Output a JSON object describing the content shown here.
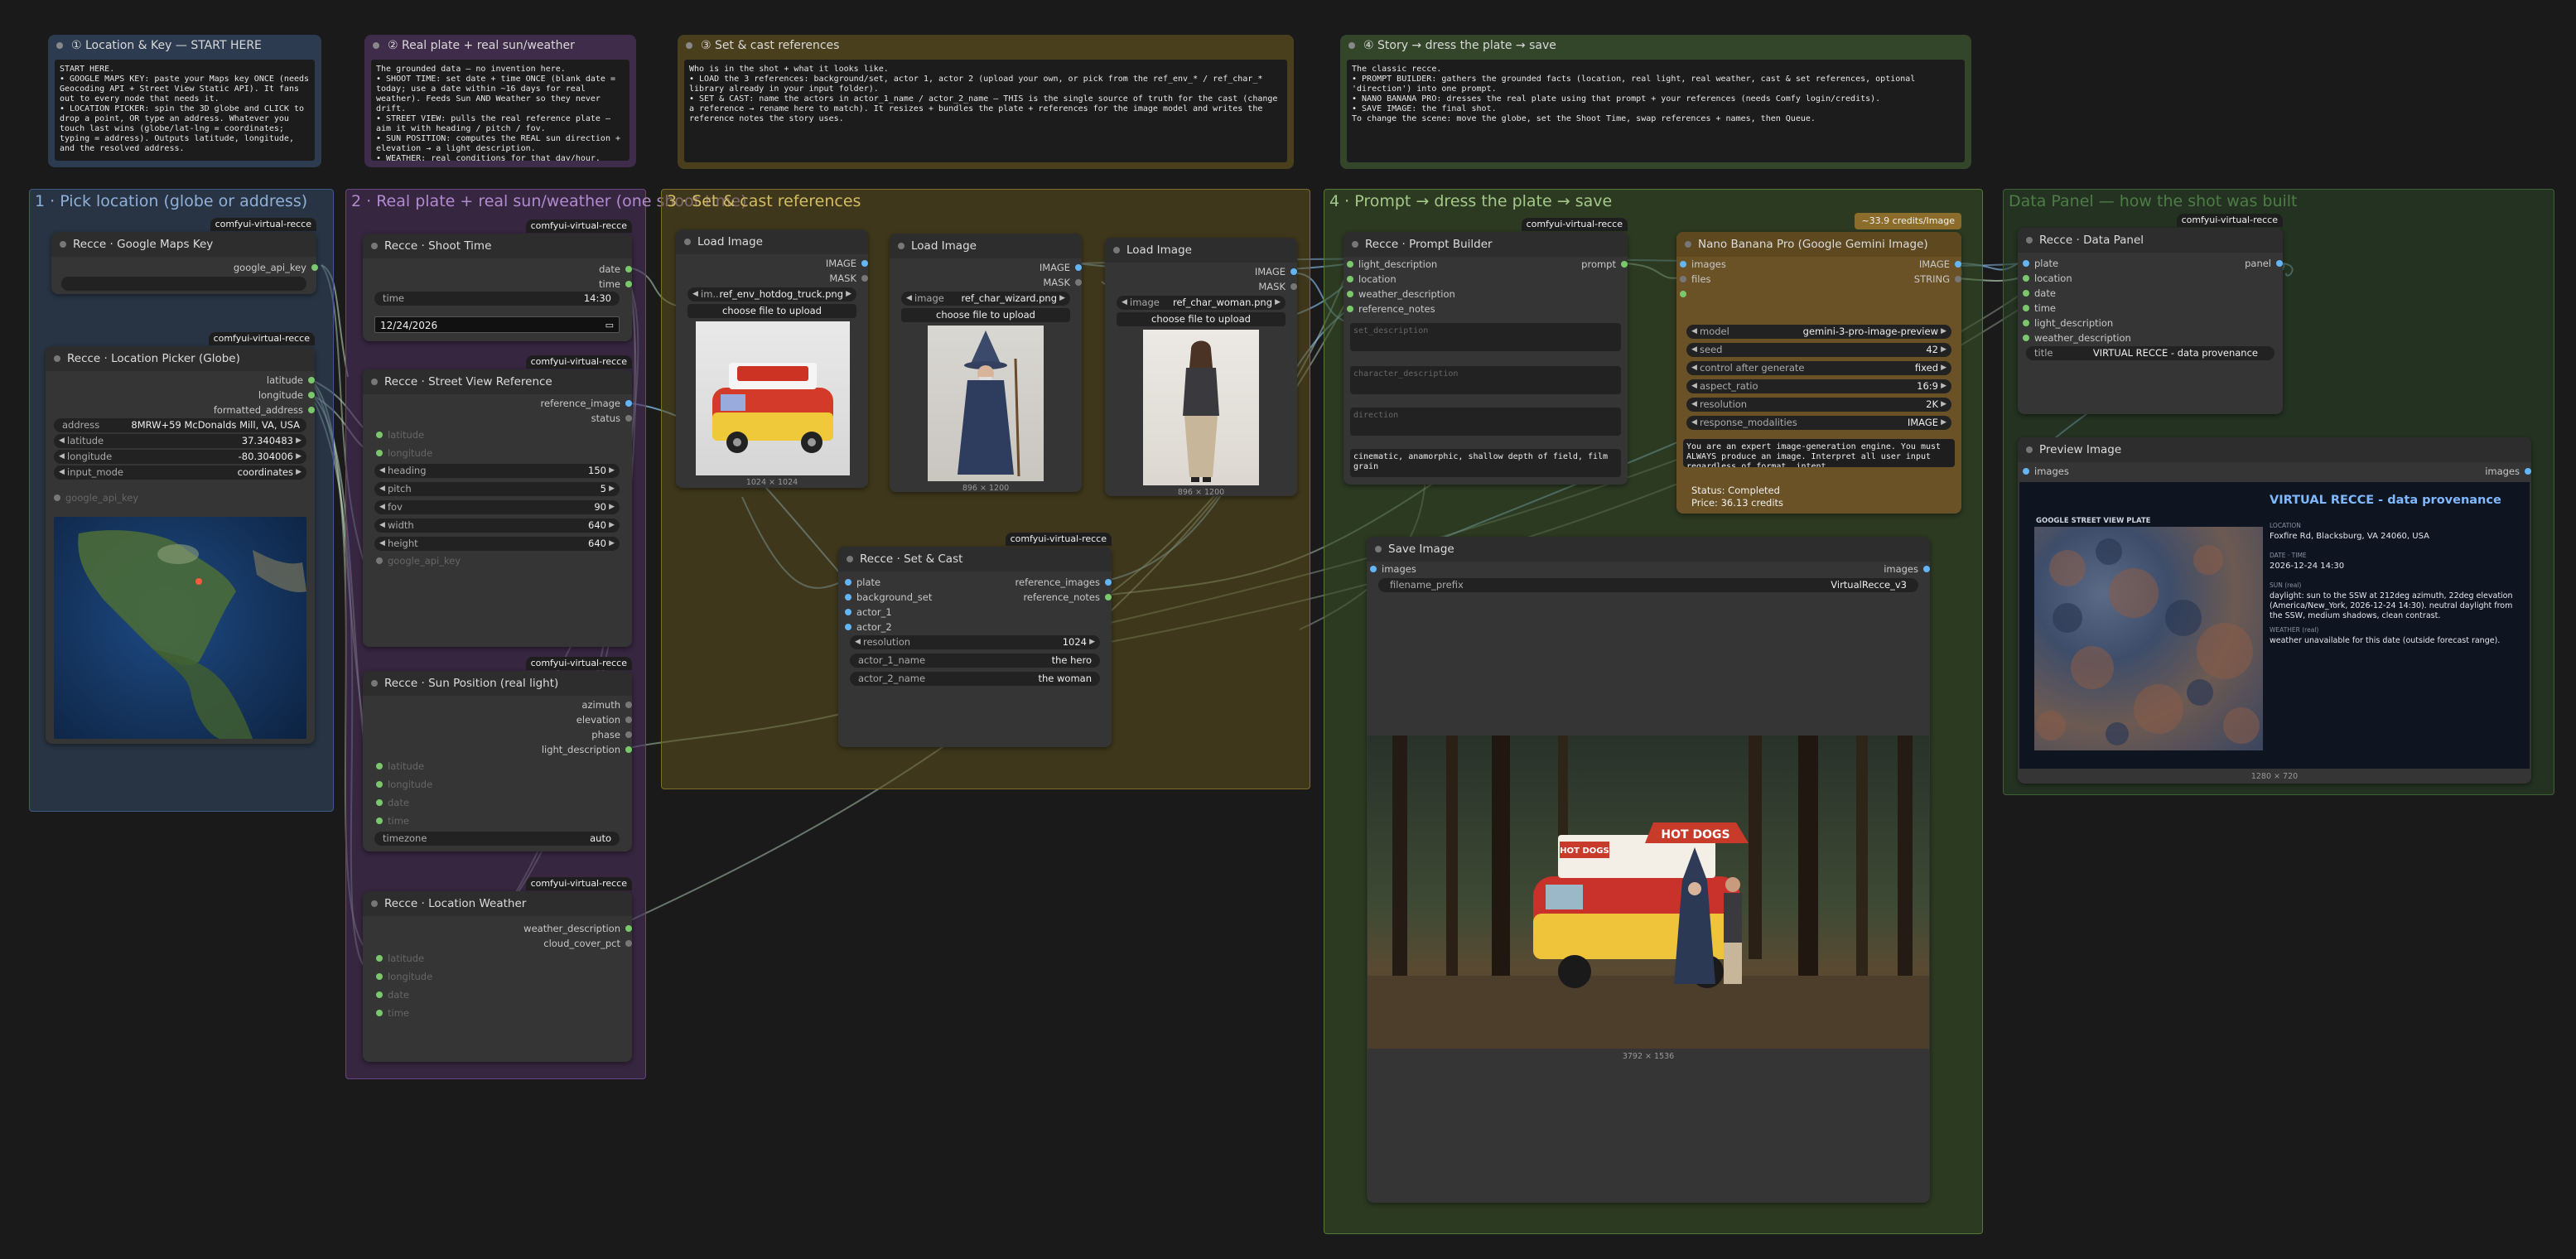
{
  "notes": [
    {
      "title": "① Location & Key — START HERE",
      "body": "START HERE.\n• GOOGLE MAPS KEY: paste your Maps key ONCE (needs Geocoding API + Street View Static API). It fans out to every node that needs it.\n• LOCATION PICKER: spin the 3D globe and CLICK to drop a point, OR type an address. Whatever you touch last wins (globe/lat-lng = coordinates; typing = address). Outputs latitude, longitude, and the resolved address."
    },
    {
      "title": "② Real plate + real sun/weather",
      "body": "The grounded data — no invention here.\n• SHOOT TIME: set date + time ONCE (blank date = today; use a date within ~16 days for real weather). Feeds Sun AND Weather so they never drift.\n• STREET VIEW: pulls the real reference plate — aim it with heading / pitch / fov.\n• SUN POSITION: computes the REAL sun direction + elevation → a light description.\n• WEATHER: real conditions for that day/hour."
    },
    {
      "title": "③ Set & cast references",
      "body": "Who is in the shot + what it looks like.\n• LOAD the 3 references: background/set, actor 1, actor 2 (upload your own, or pick from the ref_env_* / ref_char_* library already in your input folder).\n• SET & CAST: name the actors in actor_1_name / actor_2_name — THIS is the single source of truth for the cast (change a reference → rename here to match). It resizes + bundles the plate + references for the image model and writes the reference notes the story uses."
    },
    {
      "title": "④ Story → dress the plate → save",
      "body": "The classic recce.\n• PROMPT BUILDER: gathers the grounded facts (location, real light, real weather, cast & set references, optional 'direction') into one prompt.\n• NANO BANANA PRO: dresses the real plate using that prompt + your references (needs Comfy login/credits).\n• SAVE IMAGE: the final shot.\nTo change the scene: move the globe, set the Shoot Time, swap references + names, then Queue."
    }
  ],
  "groups": {
    "g1": "1 · Pick location (globe or address)",
    "g2": "2 · Real plate + real sun/weather (one shoot time)",
    "g3": "3 · Set & cast references",
    "g4": "4 · Prompt → dress the plate → save",
    "g5": "Data Panel — how the shot was built"
  },
  "badge": "comfyui-virtual-recce",
  "nodes": {
    "maps_key": {
      "title": "Recce · Google Maps Key",
      "out": "google_api_key",
      "value": ""
    },
    "picker": {
      "title": "Recce · Location Picker (Globe)",
      "outs": [
        "latitude",
        "longitude",
        "formatted_address"
      ],
      "address_label": "address",
      "address": "8MRW+59 McDonalds Mill, VA, USA",
      "lat_label": "latitude",
      "lat": "37.340483",
      "lng_label": "longitude",
      "lng": "-80.304006",
      "mode_label": "input_mode",
      "mode": "coordinates",
      "in_dim": "google_api_key"
    },
    "shoot": {
      "title": "Recce · Shoot Time",
      "outs": [
        "date",
        "time"
      ],
      "time_label": "time",
      "time": "14:30",
      "date": "12/24/2026"
    },
    "street": {
      "title": "Recce · Street View Reference",
      "outs": [
        "reference_image",
        "status"
      ],
      "ins": [
        "latitude",
        "longitude"
      ],
      "widgets": [
        [
          "heading",
          "150"
        ],
        [
          "pitch",
          "5"
        ],
        [
          "fov",
          "90"
        ],
        [
          "width",
          "640"
        ],
        [
          "height",
          "640"
        ]
      ],
      "in_dim": "google_api_key"
    },
    "sun": {
      "title": "Recce · Sun Position (real light)",
      "outs": [
        "azimuth",
        "elevation",
        "phase",
        "light_description"
      ],
      "ins": [
        "latitude",
        "longitude",
        "date",
        "time"
      ],
      "tz_label": "timezone",
      "tz": "auto"
    },
    "weather": {
      "title": "Recce · Location Weather",
      "outs": [
        "weather_description",
        "cloud_cover_pct"
      ],
      "ins": [
        "latitude",
        "longitude",
        "date",
        "time"
      ]
    },
    "load1": {
      "title": "Load Image",
      "outs": [
        "IMAGE",
        "MASK"
      ],
      "img_label": "im...",
      "file": "ref_env_hotdog_truck.png",
      "upload": "choose file to upload",
      "size": "1024 × 1024"
    },
    "load2": {
      "title": "Load Image",
      "outs": [
        "IMAGE",
        "MASK"
      ],
      "img_label": "image",
      "file": "ref_char_wizard.png",
      "upload": "choose file to upload",
      "size": "896 × 1200"
    },
    "load3": {
      "title": "Load Image",
      "outs": [
        "IMAGE",
        "MASK"
      ],
      "img_label": "image",
      "file": "ref_char_woman.png",
      "upload": "choose file to upload",
      "size": "896 × 1200"
    },
    "setcast": {
      "title": "Recce · Set & Cast",
      "ins": [
        "plate",
        "background_set",
        "actor_1",
        "actor_2"
      ],
      "outs": [
        "reference_images",
        "reference_notes"
      ],
      "res_label": "resolution",
      "res": "1024",
      "a1_label": "actor_1_name",
      "a1": "the hero",
      "a2_label": "actor_2_name",
      "a2": "the woman"
    },
    "prompt": {
      "title": "Recce · Prompt Builder",
      "ins": [
        "light_description",
        "location",
        "weather_description",
        "reference_notes"
      ],
      "out": "prompt",
      "ph": [
        "set_description",
        "character_description",
        "direction"
      ],
      "style": "cinematic, anamorphic, shallow depth of field, film grain"
    },
    "nano": {
      "title": "Nano Banana Pro (Google Gemini Image)",
      "credits": "~33.9 credits/Image",
      "ins": [
        "images",
        "files"
      ],
      "outs": [
        "IMAGE",
        "STRING"
      ],
      "widgets": [
        [
          "model",
          "gemini-3-pro-image-preview"
        ],
        [
          "seed",
          "42"
        ],
        [
          "control after generate",
          "fixed"
        ],
        [
          "aspect_ratio",
          "16:9"
        ],
        [
          "resolution",
          "2K"
        ],
        [
          "response_modalities",
          "IMAGE"
        ]
      ],
      "system": "You are an expert image-generation engine. You must ALWAYS produce an image.\nInterpret all user input regardless of format, intent,",
      "status": "Status: Completed",
      "price": "Price: 36.13 credits"
    },
    "save": {
      "title": "Save Image",
      "in": "images",
      "out": "images",
      "prefix_label": "filename_prefix",
      "prefix": "VirtualRecce_v3",
      "size": "3792 × 1536",
      "sign_left": "HOT DOGS",
      "sign_right": "HOT DOGS"
    },
    "panel": {
      "title": "Recce · Data Panel",
      "ins": [
        "plate",
        "location",
        "date",
        "time",
        "light_description",
        "weather_description"
      ],
      "out": "panel",
      "title_label": "title",
      "title_value": "VIRTUAL RECCE - data provenance"
    },
    "preview": {
      "title": "Preview Image",
      "in": "images",
      "out": "images",
      "size": "1280 × 720",
      "heading": "VIRTUAL RECCE - data provenance",
      "plate_label": "GOOGLE STREET VIEW PLATE",
      "loc_k": "LOCATION",
      "loc_v": "Foxfire Rd, Blacksburg, VA 24060, USA",
      "dt_k": "DATE · TIME",
      "dt_v": "2026-12-24 14:30",
      "sun_k": "SUN (real)",
      "sun_v": "daylight: sun to the SSW at 212deg azimuth, 22deg elevation (America/New_York, 2026-12-24 14:30). neutral daylight from the SSW, medium shadows, clean contrast.",
      "wx_k": "WEATHER (real)",
      "wx_v": "weather unavailable for this date (outside forecast range)."
    }
  }
}
